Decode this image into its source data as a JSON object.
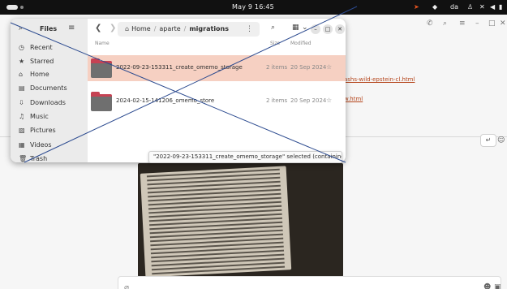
{
  "topbar": {
    "clock": "May 9  16:45",
    "lang": "da",
    "icons": [
      "activities-indicator",
      "telegram-icon",
      "network-icon",
      "accessibility-icon",
      "no-signal-icon",
      "mute-icon",
      "battery-icon"
    ]
  },
  "background_app": {
    "links": [
      "ashs-wild-epstein-cl.html",
      "w.html"
    ]
  },
  "files": {
    "sidebar_title": "Files",
    "sidebar_items": [
      {
        "label": "Recent",
        "icon": "clock-icon"
      },
      {
        "label": "Starred",
        "icon": "star-icon"
      },
      {
        "label": "Home",
        "icon": "home-icon"
      },
      {
        "label": "Documents",
        "icon": "document-icon"
      },
      {
        "label": "Downloads",
        "icon": "download-icon"
      },
      {
        "label": "Music",
        "icon": "music-icon"
      },
      {
        "label": "Pictures",
        "icon": "picture-icon"
      },
      {
        "label": "Videos",
        "icon": "video-icon"
      },
      {
        "label": "Trash",
        "icon": "trash-icon"
      }
    ],
    "path": {
      "home": "Home",
      "parent": "aparte",
      "current": "migrations"
    },
    "columns": {
      "name": "Name",
      "size": "Size",
      "modified": "Modified"
    },
    "rows": [
      {
        "name": "2022-09-23-153311_create_omemo_storage",
        "size": "2 items",
        "date": "20 Sep 2024",
        "selected": true
      },
      {
        "name": "2024-02-15-141206_omemo_store",
        "size": "2 items",
        "date": "20 Sep 2024",
        "selected": false
      }
    ],
    "status": "\"2022-09-23-153311_create_omemo_storage\" selected (containing 2 items)"
  },
  "colors": {
    "accent": "#e95420",
    "selection": "#f6d0c2",
    "folder": "#c64253"
  }
}
